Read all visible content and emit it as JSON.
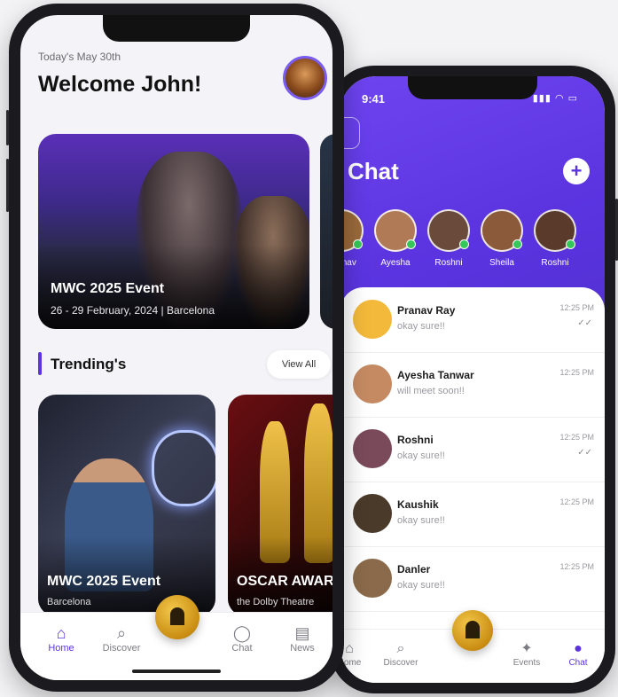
{
  "back_phone": {
    "status_time": "9:41",
    "title": "Chat",
    "stories": [
      {
        "name": "Pranav",
        "color": "#9a6a3a"
      },
      {
        "name": "Ayesha",
        "color": "#b07a56"
      },
      {
        "name": "Roshni",
        "color": "#6a4a3a"
      },
      {
        "name": "Sheila",
        "color": "#8a5a3a"
      },
      {
        "name": "Roshni",
        "color": "#5a3a2a"
      }
    ],
    "chats": [
      {
        "name": "Pranav Ray",
        "message": "okay sure!!",
        "time": "12:25 PM",
        "tick": "✓✓",
        "color": "#f2b93a"
      },
      {
        "name": "Ayesha Tanwar",
        "message": "will meet soon!!",
        "time": "12:25 PM",
        "tick": "",
        "color": "#c58a62"
      },
      {
        "name": "Roshni",
        "message": "okay sure!!",
        "time": "12:25 PM",
        "tick": "✓✓",
        "color": "#7a4a5a"
      },
      {
        "name": "Kaushik",
        "message": "okay sure!!",
        "time": "12:25 PM",
        "tick": "",
        "color": "#4a3a2a"
      },
      {
        "name": "Danler",
        "message": "okay sure!!",
        "time": "12:25 PM",
        "tick": "",
        "color": "#8a6a4a"
      }
    ],
    "nav": [
      {
        "label": "Home",
        "icon": "home-icon"
      },
      {
        "label": "Discover",
        "icon": "search-icon"
      },
      {
        "label": "Events",
        "icon": "party-icon"
      },
      {
        "label": "Chat",
        "icon": "chat-icon"
      }
    ]
  },
  "front_phone": {
    "date": "Today's May 30th",
    "welcome": "Welcome John!",
    "event_card": {
      "title": "MWC 2025 Event",
      "subtitle": "26 - 29 February, 2024  |  Barcelona"
    },
    "trending_title": "Trending's",
    "view_all": "View All",
    "trending": [
      {
        "title": "MWC 2025 Event",
        "subtitle": "Barcelona"
      },
      {
        "title": "OSCAR AWARDS",
        "subtitle": "the Dolby Theatre"
      }
    ],
    "nav": [
      {
        "label": "Home",
        "icon": "home-icon"
      },
      {
        "label": "Discover",
        "icon": "search-icon"
      },
      {
        "label": "Chat",
        "icon": "chat-icon"
      },
      {
        "label": "News",
        "icon": "news-icon"
      }
    ],
    "accent": "#5b34e0"
  }
}
